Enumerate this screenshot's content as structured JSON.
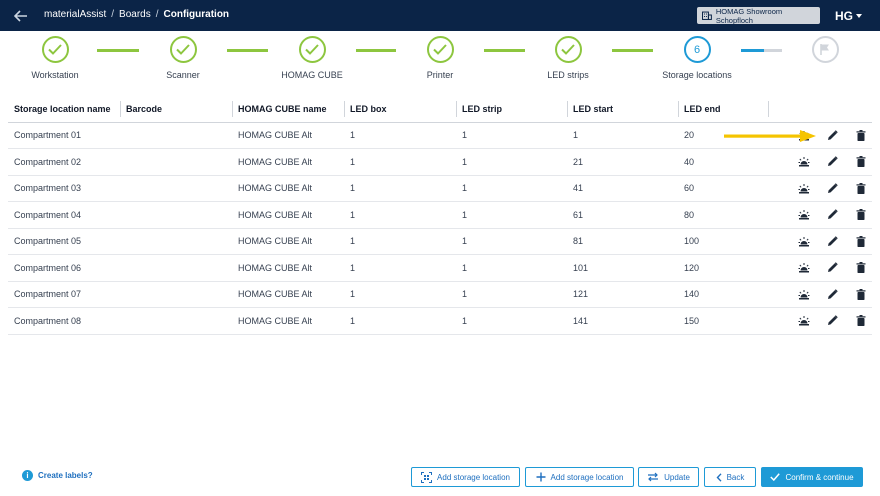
{
  "header": {
    "app_name": "materialAssist",
    "section": "Boards",
    "page": "Configuration",
    "location": "HOMAG Showroom Schopfloch",
    "brand": "HG"
  },
  "stepper": {
    "steps": [
      {
        "label": "Workstation",
        "state": "done"
      },
      {
        "label": "Scanner",
        "state": "done"
      },
      {
        "label": "HOMAG CUBE",
        "state": "done"
      },
      {
        "label": "Printer",
        "state": "done"
      },
      {
        "label": "LED strips",
        "state": "done"
      },
      {
        "label": "Storage locations",
        "state": "active",
        "number": "6"
      },
      {
        "label": "",
        "state": "pending"
      }
    ],
    "colors": {
      "done": "#8dc63f",
      "active": "#1e9ad6",
      "pending": "#d1d5db"
    }
  },
  "table": {
    "headers": [
      "Storage location name",
      "Barcode",
      "HOMAG CUBE name",
      "LED box",
      "LED strip",
      "LED start",
      "LED end"
    ],
    "rows": [
      {
        "name": "Compartment 01",
        "barcode": "",
        "cube": "HOMAG CUBE Alt",
        "led_box": "1",
        "led_strip": "1",
        "led_start": "1",
        "led_end": "20"
      },
      {
        "name": "Compartment 02",
        "barcode": "",
        "cube": "HOMAG CUBE Alt",
        "led_box": "1",
        "led_strip": "1",
        "led_start": "21",
        "led_end": "40"
      },
      {
        "name": "Compartment 03",
        "barcode": "",
        "cube": "HOMAG CUBE Alt",
        "led_box": "1",
        "led_strip": "1",
        "led_start": "41",
        "led_end": "60"
      },
      {
        "name": "Compartment 04",
        "barcode": "",
        "cube": "HOMAG CUBE Alt",
        "led_box": "1",
        "led_strip": "1",
        "led_start": "61",
        "led_end": "80"
      },
      {
        "name": "Compartment 05",
        "barcode": "",
        "cube": "HOMAG CUBE Alt",
        "led_box": "1",
        "led_strip": "1",
        "led_start": "81",
        "led_end": "100"
      },
      {
        "name": "Compartment 06",
        "barcode": "",
        "cube": "HOMAG CUBE Alt",
        "led_box": "1",
        "led_strip": "1",
        "led_start": "101",
        "led_end": "120"
      },
      {
        "name": "Compartment 07",
        "barcode": "",
        "cube": "HOMAG CUBE Alt",
        "led_box": "1",
        "led_strip": "1",
        "led_start": "121",
        "led_end": "140"
      },
      {
        "name": "Compartment 08",
        "barcode": "",
        "cube": "HOMAG CUBE Alt",
        "led_box": "1",
        "led_strip": "1",
        "led_start": "141",
        "led_end": "150"
      }
    ],
    "row_actions": [
      "light-icon",
      "edit-icon",
      "delete-icon"
    ]
  },
  "footer": {
    "help_label": "Create labels?",
    "btn_add_scan": "Add storage location",
    "btn_add": "Add storage location",
    "btn_update": "Update",
    "btn_back": "Back",
    "btn_confirm": "Confirm & continue"
  },
  "colors": {
    "header_bg": "#0b2447",
    "accent": "#1e9ad6",
    "success": "#8dc63f",
    "annotation_arrow": "#f5c400"
  }
}
